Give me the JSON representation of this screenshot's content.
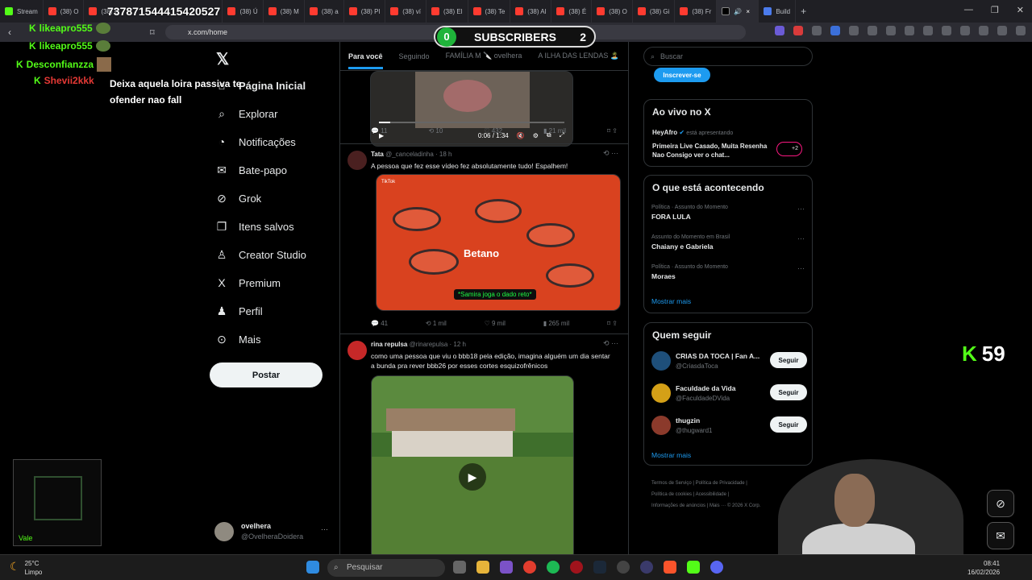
{
  "browser": {
    "tabs": [
      {
        "label": "Stream",
        "kind": "k"
      },
      {
        "label": "(38) O",
        "kind": "yt"
      },
      {
        "label": "(38) C",
        "kind": "yt"
      },
      {
        "label": "(38) Ú",
        "kind": "yt"
      },
      {
        "label": "(38) M",
        "kind": "yt"
      },
      {
        "label": "(38) a",
        "kind": "yt"
      },
      {
        "label": "(38) Pl",
        "kind": "yt"
      },
      {
        "label": "(38) ví",
        "kind": "yt"
      },
      {
        "label": "(38) El",
        "kind": "yt"
      },
      {
        "label": "(38) Te",
        "kind": "yt"
      },
      {
        "label": "(38) Al",
        "kind": "yt"
      },
      {
        "label": "(38) É",
        "kind": "yt"
      },
      {
        "label": "(38) O",
        "kind": "yt"
      },
      {
        "label": "(38) Gi",
        "kind": "yt"
      },
      {
        "label": "(38) Fr",
        "kind": "yt"
      },
      {
        "label": "",
        "kind": "x"
      },
      {
        "label": "Build",
        "kind": "b"
      }
    ],
    "url": "x.com/home"
  },
  "overlay": {
    "donation_id": "737871544415420527",
    "subs_left": "0",
    "subs_label": "SUBSCRIBERS",
    "subs_right": "2",
    "chat": [
      {
        "user": "likeapro555",
        "color": "#53fc18",
        "text": ""
      },
      {
        "user": "likeapro555",
        "color": "#53fc18",
        "text": ""
      },
      {
        "user": "Desconfianzza",
        "color": "#53fc18",
        "text": ""
      },
      {
        "user": "Shevii2kkk",
        "color": "#e53935",
        "text": "Deixa aquela loira passiva te ofender nao fall"
      }
    ],
    "kick_count": "59",
    "vale_label": "Vale"
  },
  "nav": {
    "items": [
      {
        "label": "Página Inicial",
        "icon": "⌂"
      },
      {
        "label": "Explorar",
        "icon": "⌕"
      },
      {
        "label": "Notificações",
        "icon": "◔"
      },
      {
        "label": "Bate-papo",
        "icon": "✉"
      },
      {
        "label": "Grok",
        "icon": "⊘"
      },
      {
        "label": "Itens salvos",
        "icon": "❐"
      },
      {
        "label": "Creator Studio",
        "icon": "♙"
      },
      {
        "label": "Premium",
        "icon": "X"
      },
      {
        "label": "Perfil",
        "icon": "♟"
      },
      {
        "label": "Mais",
        "icon": "⊙"
      }
    ],
    "post_button": "Postar",
    "account_name": "ovelhera",
    "account_handle": "@OvelheraDoidera"
  },
  "feed": {
    "tabs": [
      "Para você",
      "Seguindo",
      "FAMÍLIA M 🔪 ovelhera",
      "A ILHA DAS LENDAS 🏝️"
    ],
    "video1": {
      "time": "0:06 / 1:34",
      "replies": "11",
      "reposts": "10",
      "likes": "432",
      "views": "21 mil"
    },
    "tweet2": {
      "name": "Tata",
      "handle": "@_canceladinha · 18 h",
      "text": "A pessoa que fez esse vídeo fez absolutamente tudo! Espalhem!",
      "media_brand": "Betano",
      "media_caption": "*Samira joga o dado reto*",
      "media_watermark": "TikTok",
      "replies": "41",
      "reposts": "1 mil",
      "likes": "9 mil",
      "views": "265 mil"
    },
    "tweet3": {
      "name": "rina repulsa",
      "handle": "@rinarepulsa · 12 h",
      "text": "como uma pessoa que viu o bbb18 pela edição, imagina alguém um dia sentar a bunda pra rever bbb26 por esses cortes esquizofrênicos"
    }
  },
  "sidebar": {
    "search_placeholder": "Buscar",
    "subscribe_button": "Inscrever-se",
    "live_title": "Ao vivo no X",
    "live_host": "HeyAfro",
    "live_status": "está apresentando",
    "live_text": "Primeira Live Casado, Muita Resenha Nao Consigo ver o chat...",
    "live_extra": "+2",
    "trends_title": "O que está acontecendo",
    "trends": [
      {
        "context": "Política · Assunto do Momento",
        "topic": "FORA LULA"
      },
      {
        "context": "Assunto do Momento em Brasil",
        "topic": "Chaiany e Gabriela"
      },
      {
        "context": "Política · Assunto do Momento",
        "topic": "Moraes"
      }
    ],
    "show_more": "Mostrar mais",
    "follow_title": "Quem seguir",
    "follow": [
      {
        "name": "CRIAS DA TOCA | Fan A...",
        "handle": "@CriasdaToca"
      },
      {
        "name": "Faculdade da Vida",
        "handle": "@FaculdadeDVida"
      },
      {
        "name": "thugzin",
        "handle": "@thugward1"
      }
    ],
    "follow_button": "Seguir",
    "footer": [
      "Termos de Serviço",
      "Política de Privacidade",
      "Política de cookies",
      "Acessibilidade",
      "Informações de anúncios",
      "Mais ···",
      "© 2026 X Corp."
    ]
  },
  "taskbar": {
    "temp": "25°C",
    "weather": "Limpo",
    "search": "Pesquisar",
    "time": "08:41",
    "date": "16/02/2026"
  }
}
